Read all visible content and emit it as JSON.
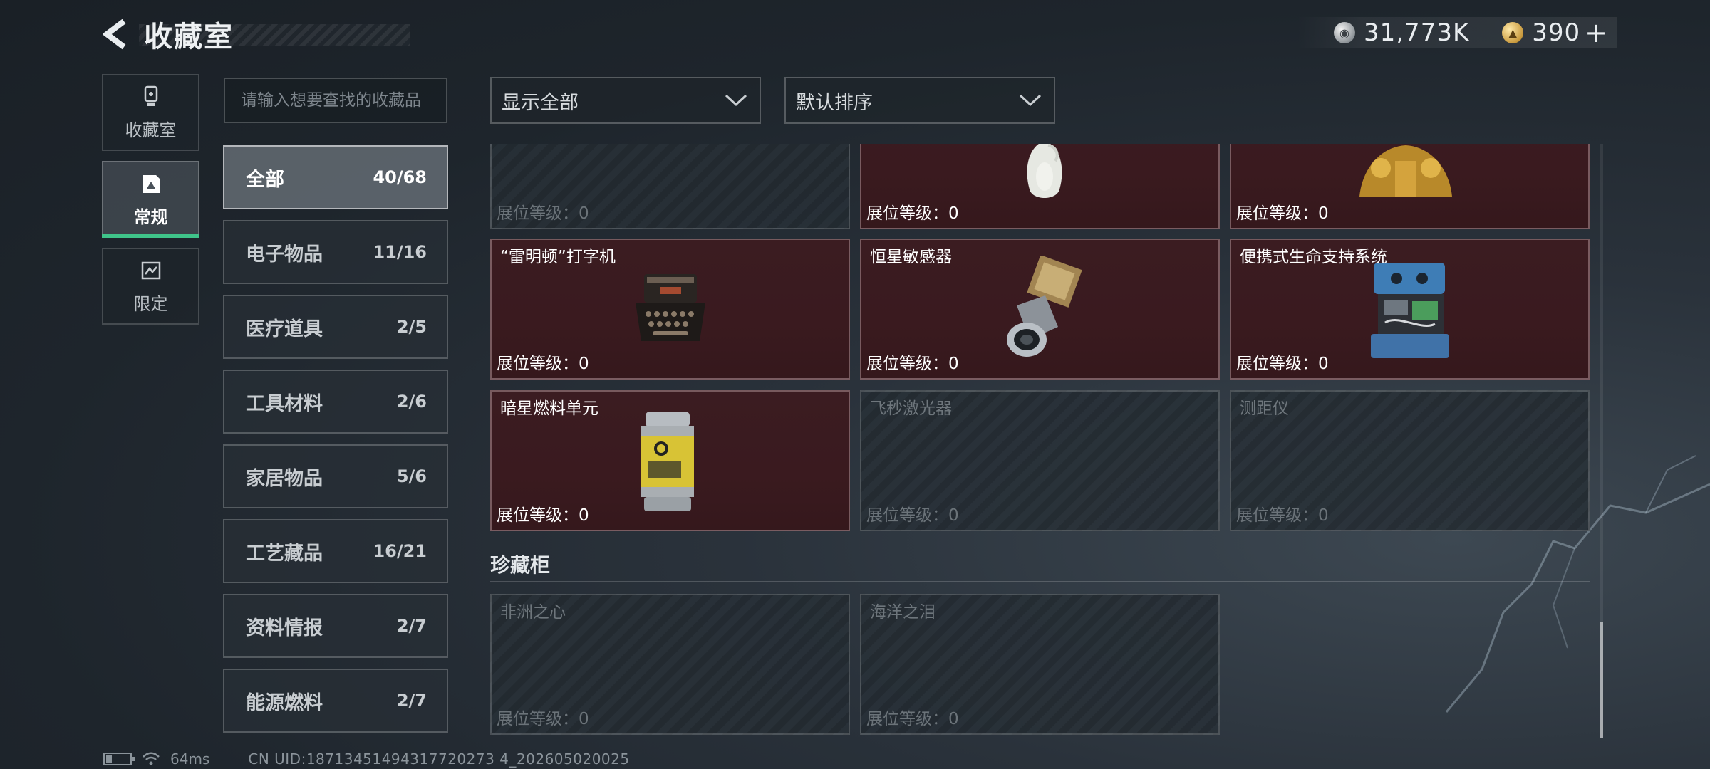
{
  "header": {
    "title": "收藏室"
  },
  "currency": {
    "silver": "31,773K",
    "gold": "390",
    "plus": "+"
  },
  "side_tabs": [
    {
      "label": "收藏室",
      "icon": "trophy-icon"
    },
    {
      "label": "常规",
      "icon": "gallery-icon",
      "active": true
    },
    {
      "label": "限定",
      "icon": "limited-icon"
    }
  ],
  "search": {
    "placeholder": "请输入想要查找的收藏品"
  },
  "categories": [
    {
      "name": "全部",
      "count": "40/68",
      "active": true
    },
    {
      "name": "电子物品",
      "count": "11/16"
    },
    {
      "name": "医疗道具",
      "count": "2/5"
    },
    {
      "name": "工具材料",
      "count": "2/6"
    },
    {
      "name": "家居物品",
      "count": "5/6"
    },
    {
      "name": "工艺藏品",
      "count": "16/21"
    },
    {
      "name": "资料情报",
      "count": "2/7"
    },
    {
      "name": "能源燃料",
      "count": "2/7"
    }
  ],
  "filters": {
    "display": "显示全部",
    "sort": "默认排序"
  },
  "level_label": "展位等级：",
  "cards": [
    {
      "name": "",
      "level": "0",
      "owned": false
    },
    {
      "name": "",
      "level": "0",
      "owned": true,
      "icon": "vase-icon"
    },
    {
      "name": "",
      "level": "0",
      "owned": true,
      "icon": "golden-statue-icon"
    },
    {
      "name": "“雷明顿”打字机",
      "level": "0",
      "owned": true,
      "icon": "typewriter-icon"
    },
    {
      "name": "恒星敏感器",
      "level": "0",
      "owned": true,
      "icon": "star-sensor-icon"
    },
    {
      "name": "便携式生命支持系统",
      "level": "0",
      "owned": true,
      "icon": "life-support-icon"
    },
    {
      "name": "暗星燃料单元",
      "level": "0",
      "owned": true,
      "icon": "fuel-cell-icon"
    },
    {
      "name": "飞秒激光器",
      "level": "0",
      "owned": false
    },
    {
      "name": "测距仪",
      "level": "0",
      "owned": false
    }
  ],
  "showcase": {
    "title": "珍藏柜",
    "cards": [
      {
        "name": "非洲之心",
        "level": "0",
        "owned": false
      },
      {
        "name": "海洋之泪",
        "level": "0",
        "owned": false
      }
    ]
  },
  "footer": {
    "ping": "64ms",
    "uid": "CN UID:18713451494317720273 4_202605020025"
  },
  "colors": {
    "accent": "#3fc48a",
    "owned_card": "#3b1c21"
  }
}
